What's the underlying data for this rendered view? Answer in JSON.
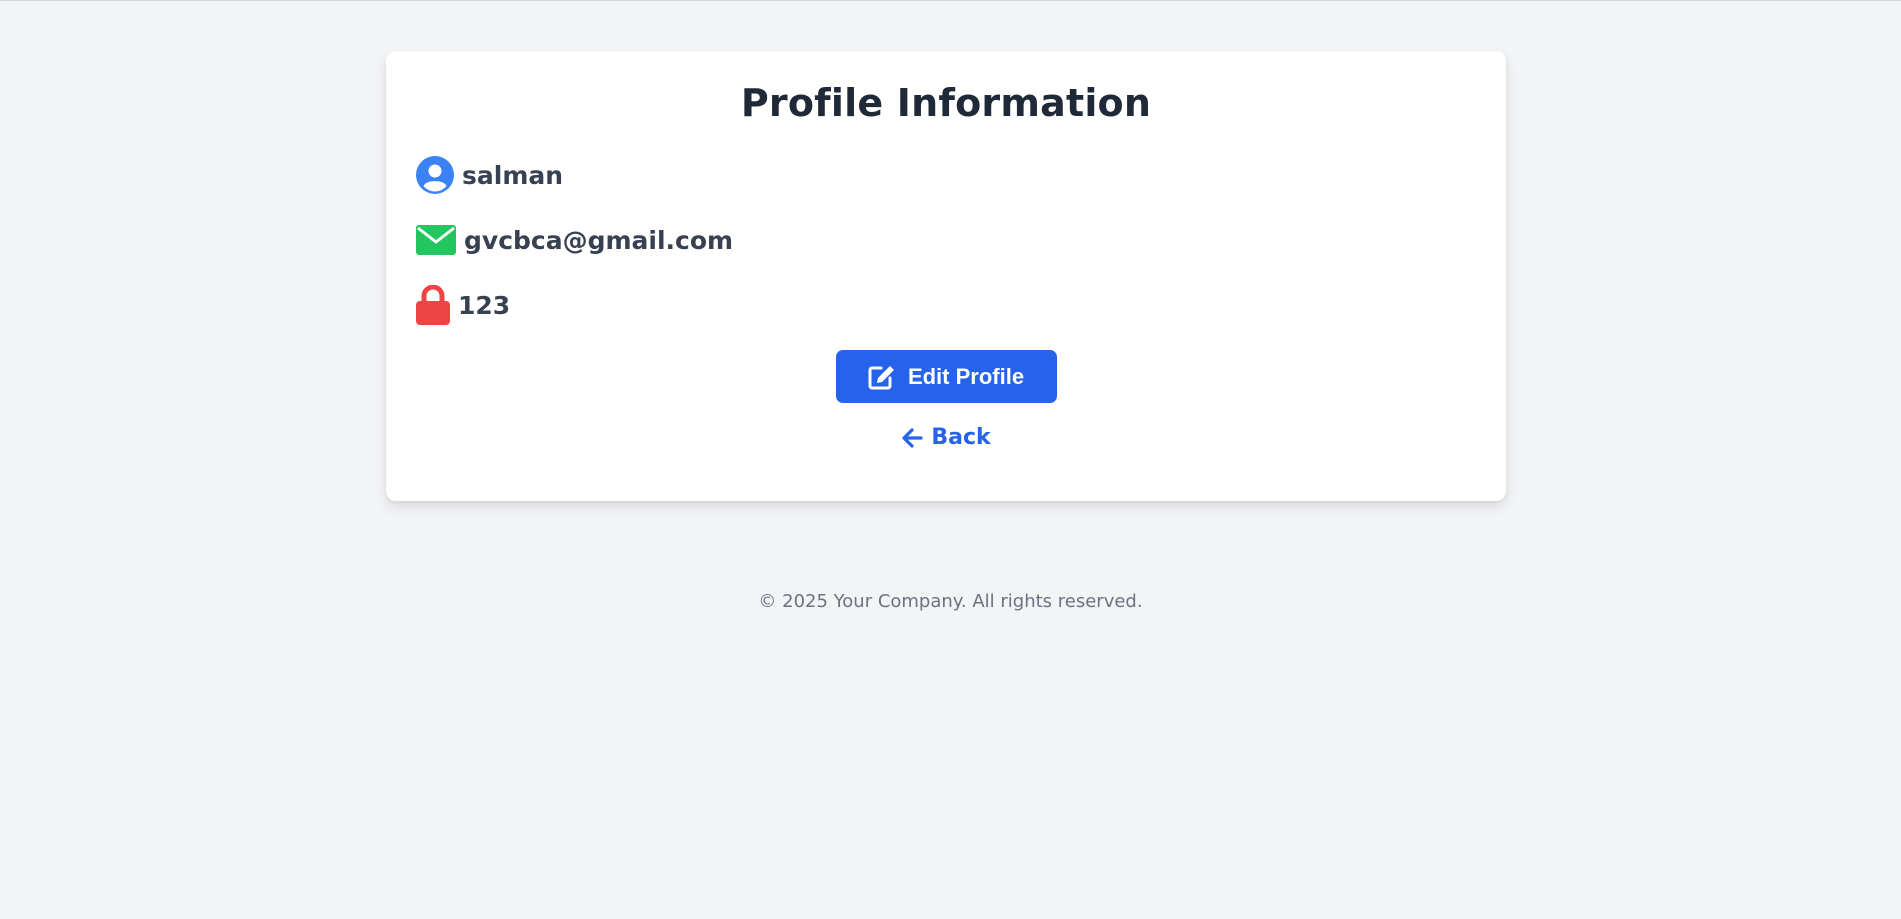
{
  "profile": {
    "title": "Profile Information",
    "username": "salman",
    "email": "gvcbca@gmail.com",
    "password": "123",
    "icons": {
      "user": "user-circle-icon",
      "email": "envelope-icon",
      "password": "lock-icon"
    },
    "icon_colors": {
      "user": "#3b82f6",
      "email": "#22c55e",
      "password": "#ef4444"
    }
  },
  "actions": {
    "edit_label": "Edit Profile",
    "edit_icon": "edit-icon",
    "back_label": "Back",
    "back_icon": "arrow-left-icon"
  },
  "footer": {
    "text": "© 2025 Your Company. All rights reserved."
  },
  "colors": {
    "accent": "#2563eb",
    "background": "#f3f4f6"
  }
}
